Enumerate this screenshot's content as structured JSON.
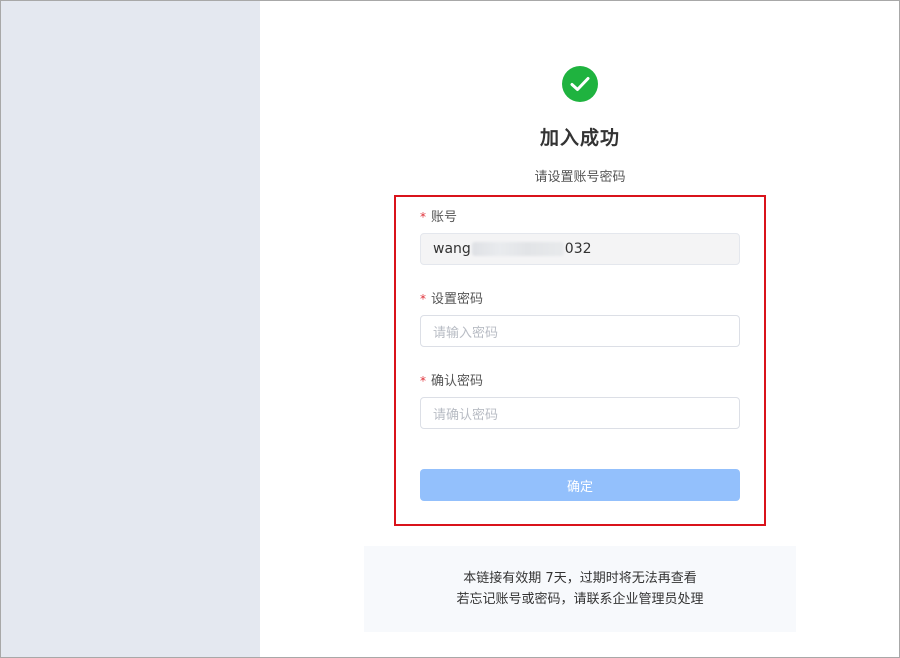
{
  "header": {
    "title": "加入成功",
    "subtitle": "请设置账号密码"
  },
  "form": {
    "account": {
      "label": "账号",
      "required_mark": "*",
      "value_prefix": "wang",
      "value_suffix": "032"
    },
    "password": {
      "label": "设置密码",
      "required_mark": "*",
      "placeholder": "请输入密码"
    },
    "confirm_password": {
      "label": "确认密码",
      "required_mark": "*",
      "placeholder": "请确认密码"
    },
    "submit_label": "确定"
  },
  "notice": {
    "line1": "本链接有效期 7天，过期时将无法再查看",
    "line2": "若忘记账号或密码，请联系企业管理员处理"
  },
  "colors": {
    "success": "#1fb33f",
    "highlight_border": "#d9131b",
    "button_disabled": "#93c0fc",
    "sidebar": "#e4e8f0"
  },
  "icons": {
    "success": "check-circle-icon"
  }
}
